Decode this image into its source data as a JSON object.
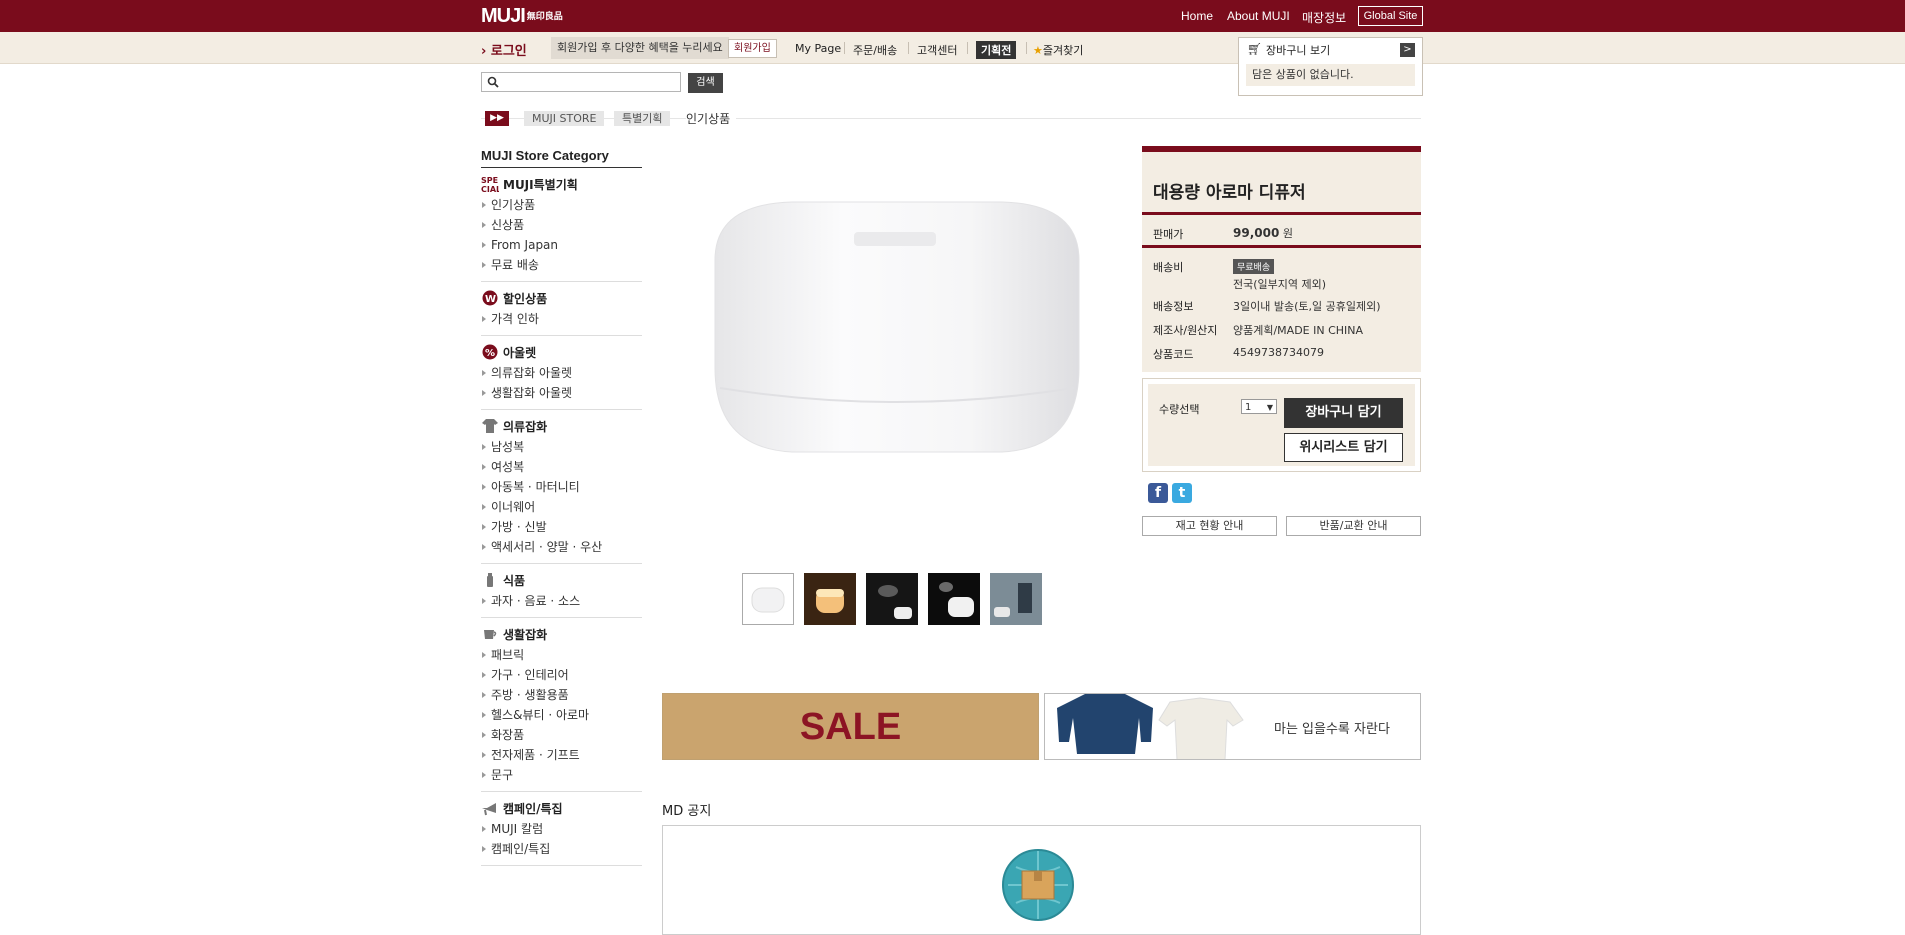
{
  "header": {
    "logo": "MUJI",
    "logo_sub": "無印良品",
    "nav": [
      "Home",
      "About MUJI",
      "매장정보"
    ],
    "global_site": "Global Site"
  },
  "subbar": {
    "login": "로그인",
    "join_message": "회원가입 후 다양한 혜택을 누리세요",
    "join_button": "회원가입",
    "links": [
      "My Page",
      "주문/배송",
      "고객센터"
    ],
    "special": "기획전",
    "favorite": "즐겨찾기"
  },
  "cart": {
    "title": "장바구니 보기",
    "empty": "담은 상품이 없습니다."
  },
  "search": {
    "placeholder": "",
    "button": "검색"
  },
  "breadcrumb": {
    "items": [
      "MUJI STORE",
      "특별기획"
    ],
    "current": "인기상품"
  },
  "sidebar": {
    "title": "MUJI Store Category",
    "groups": [
      {
        "title": "MUJI특별기획",
        "icon": "special-icon",
        "items": [
          "인기상품",
          "신상품",
          "From Japan",
          "무료 배송"
        ]
      },
      {
        "title": "할인상품",
        "icon": "won-icon",
        "items": [
          "가격 인하"
        ]
      },
      {
        "title": "아울렛",
        "icon": "percent-icon",
        "items": [
          "의류잡화 아울렛",
          "생활잡화 아울렛"
        ]
      },
      {
        "title": "의류잡화",
        "icon": "shirt-icon",
        "items": [
          "남성복",
          "여성복",
          "아동복 · 마터니티",
          "이너웨어",
          "가방 · 신발",
          "액세서리 · 양말 · 우산"
        ]
      },
      {
        "title": "식품",
        "icon": "bottle-icon",
        "items": [
          "과자 · 음료 · 소스"
        ]
      },
      {
        "title": "생활잡화",
        "icon": "cup-icon",
        "items": [
          "패브릭",
          "가구 · 인테리어",
          "주방 · 생활용품",
          "헬스&뷰티 · 아로마",
          "화장품",
          "전자제품 · 기프트",
          "문구"
        ]
      },
      {
        "title": "캠페인/특집",
        "icon": "megaphone-icon",
        "items": [
          "MUJI 칼럼",
          "캠페인/특집"
        ]
      }
    ]
  },
  "product": {
    "name": "대용량 아로마 디퓨저",
    "price_label": "판매가",
    "price": "99,000",
    "price_unit": "원",
    "shipping_label": "배송비",
    "shipping_badge": "무료배송",
    "shipping_note": "전국(일부지역 제외)",
    "delivery_label": "배송정보",
    "delivery_value": "3일이내 발송(토,일 공휴일제외)",
    "maker_label": "제조사/원산지",
    "maker_value": "양품계획/MADE IN CHINA",
    "code_label": "상품코드",
    "code_value": "4549738734079",
    "qty_label": "수량선택",
    "qty_value": "1",
    "cart_button": "장바구니 담기",
    "wish_button": "위시리스트 담기",
    "stock_button": "재고 현황 안내",
    "return_button": "반품/교환 안내"
  },
  "banners": {
    "sale": "SALE",
    "clothing": "마는 입을수록 자란다"
  },
  "md": {
    "title": "MD 공지"
  },
  "colors": {
    "brand": "#7a0c1c",
    "panel": "#f3ede3"
  }
}
